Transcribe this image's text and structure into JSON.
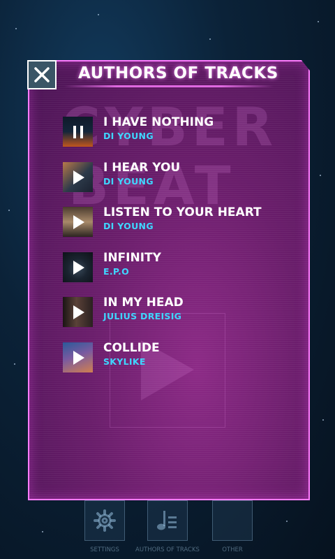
{
  "panel": {
    "title": "AUTHORS OF TRACKS"
  },
  "watermark": {
    "line1": "CYBER",
    "line2": "BEAT"
  },
  "tracks": [
    {
      "title": "I HAVE NOTHING",
      "author": "DI YOUNG",
      "state": "playing",
      "control_icon": "pause-icon"
    },
    {
      "title": "I HEAR YOU",
      "author": "DI YOUNG",
      "state": "stopped",
      "control_icon": "play-icon"
    },
    {
      "title": "LISTEN TO YOUR HEART",
      "author": "DI YOUNG",
      "state": "stopped",
      "control_icon": "play-icon"
    },
    {
      "title": "INFINITY",
      "author": "E.P.O",
      "state": "stopped",
      "control_icon": "play-icon"
    },
    {
      "title": "IN MY HEAD",
      "author": "JULIUS DREISIG",
      "state": "stopped",
      "control_icon": "play-icon"
    },
    {
      "title": "COLLIDE",
      "author": "SKYLIKE",
      "state": "stopped",
      "control_icon": "play-icon"
    }
  ],
  "nav": {
    "settings": "SETTINGS",
    "authors": "AUTHORS OF TRACKS",
    "other": "OTHER"
  },
  "icons": {
    "close": "close-icon",
    "settings": "gear-icon",
    "authors": "music-list-icon"
  },
  "colors": {
    "panel_border": "#ff7cff",
    "author_text": "#3fd6ff",
    "title_text": "#ffffff"
  }
}
